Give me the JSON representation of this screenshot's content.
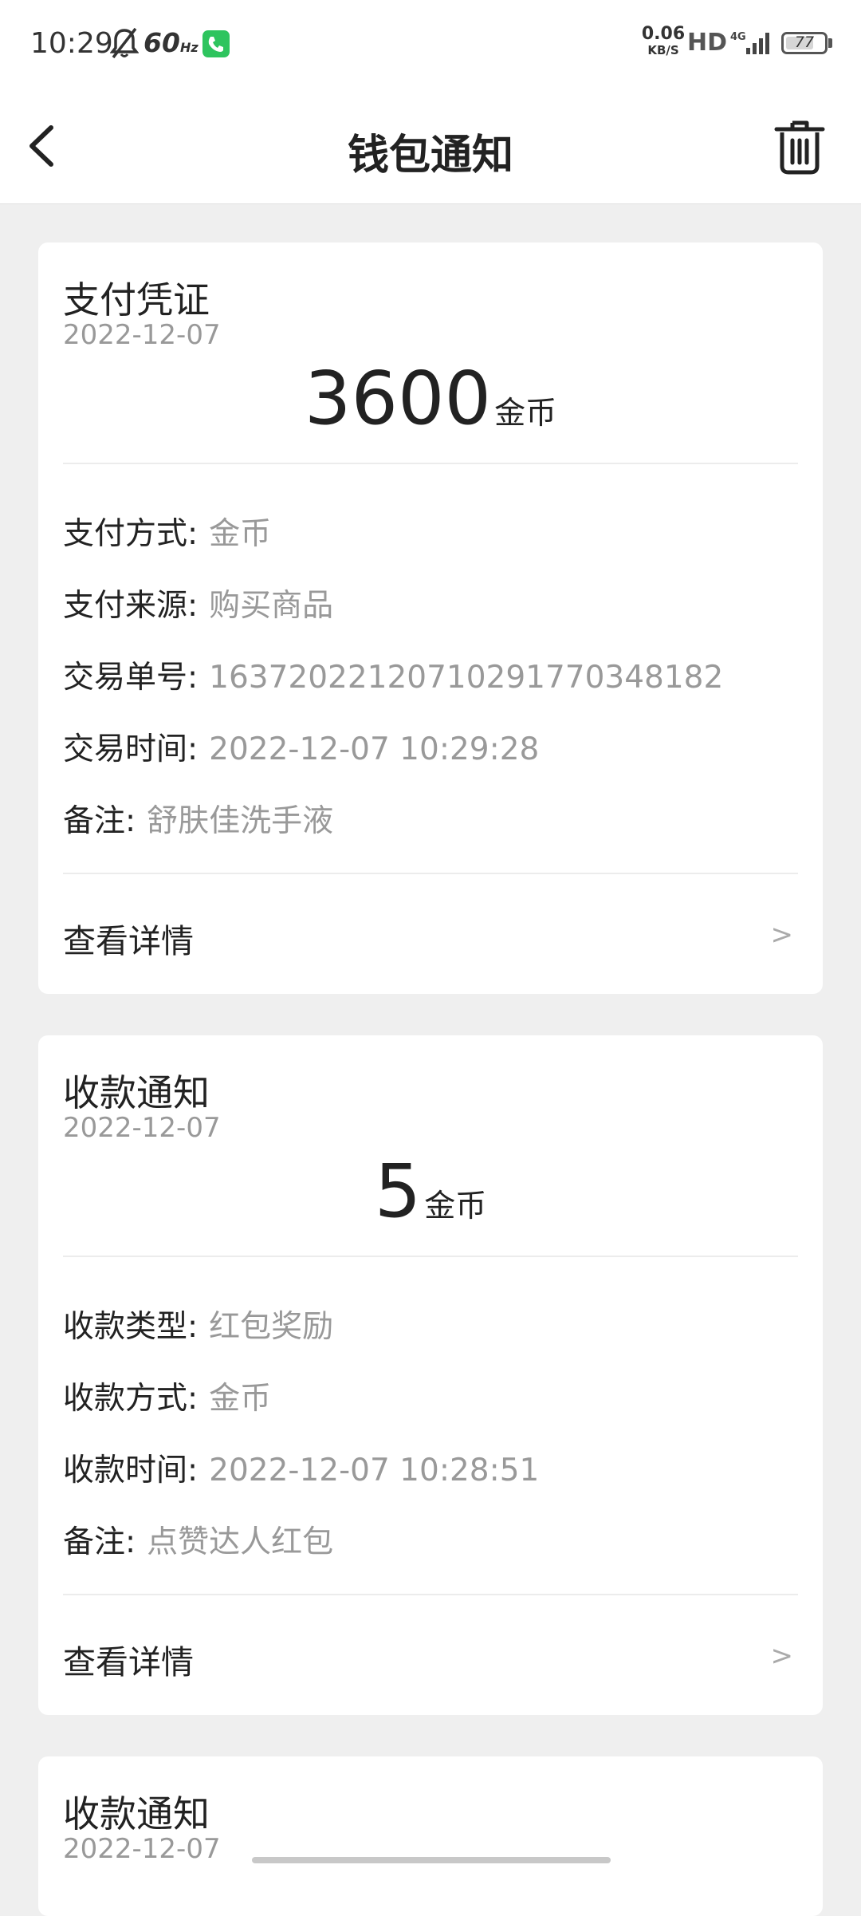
{
  "status_bar": {
    "time": "10:29",
    "refresh": "60",
    "refresh_unit": "Hz",
    "net_speed": "0.06",
    "net_unit": "KB/S",
    "hd": "HD",
    "network": "4G",
    "battery": "77",
    "icons": [
      "mute-bell-icon",
      "phone-call-icon",
      "signal-icon",
      "battery-icon"
    ]
  },
  "header": {
    "title": "钱包通知",
    "back_icon": "chevron-left-icon",
    "delete_icon": "trash-icon"
  },
  "cards": [
    {
      "title": "支付凭证",
      "date": "2022-12-07",
      "amount": "3600",
      "unit": "金币",
      "details": [
        {
          "label": "支付方式:",
          "value": "金币"
        },
        {
          "label": "支付来源:",
          "value": "购买商品"
        },
        {
          "label": "交易单号:",
          "value": "1637202212071029177034818​2"
        },
        {
          "label": "交易时间:",
          "value": "2022-12-07 10:29:28"
        },
        {
          "label": "备注:",
          "value": "舒肤佳洗手液"
        }
      ],
      "action": "查看详情",
      "chevron": ">"
    },
    {
      "title": "收款通知",
      "date": "2022-12-07",
      "amount": "5",
      "unit": "金币",
      "details": [
        {
          "label": "收款类型:",
          "value": "红包奖励"
        },
        {
          "label": "收款方式:",
          "value": "金币"
        },
        {
          "label": "收款时间:",
          "value": "2022-12-07 10:28:51"
        },
        {
          "label": "备注:",
          "value": "点赞达人红包"
        }
      ],
      "action": "查看详情",
      "chevron": ">"
    },
    {
      "title": "收款通知",
      "date": "2022-12-07"
    }
  ],
  "colors": {
    "background": "#efefef",
    "card": "#ffffff",
    "secondary_text": "#999999",
    "primary_text": "#222222",
    "call_badge": "#2ec45e"
  }
}
